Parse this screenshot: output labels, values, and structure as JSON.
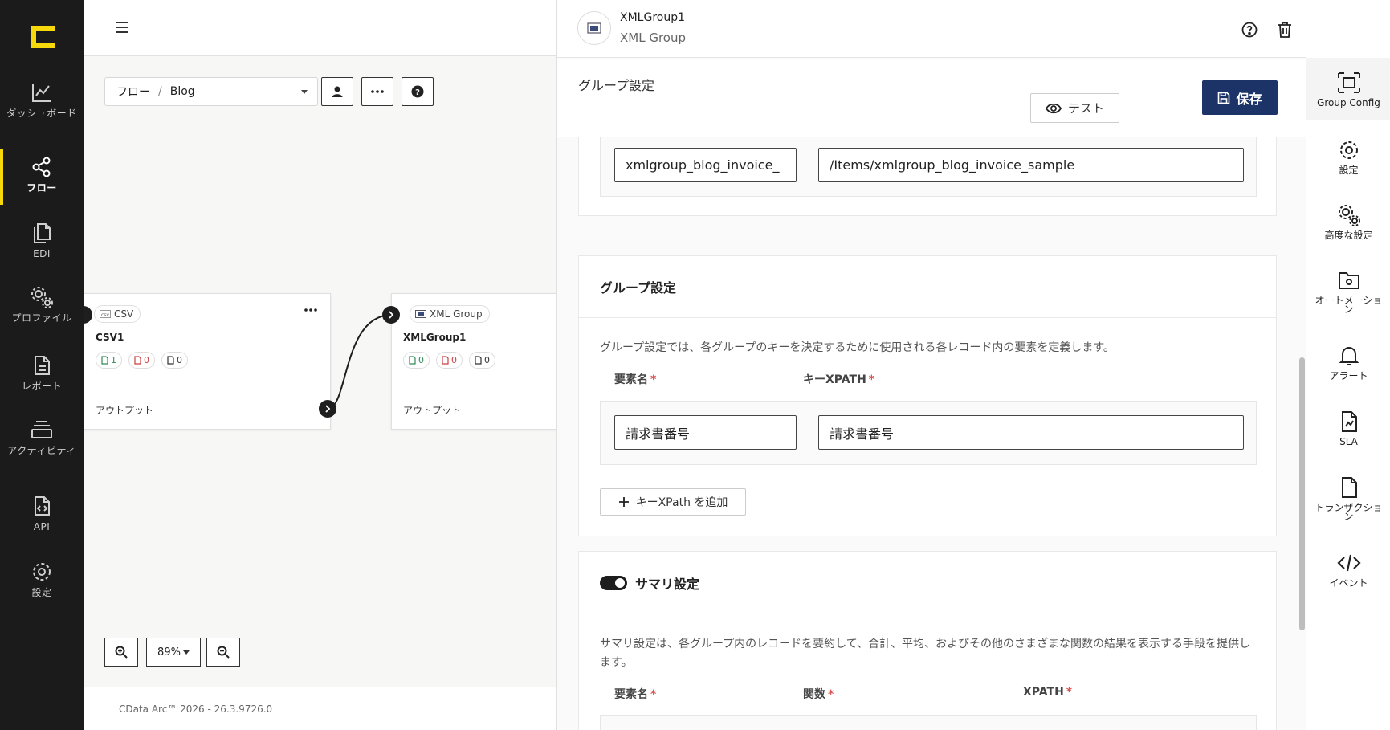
{
  "nav": {
    "items": [
      {
        "label": "ダッシュボード",
        "icon": "chart-line-icon"
      },
      {
        "label": "フロー",
        "icon": "share-nodes-icon"
      },
      {
        "label": "EDI",
        "icon": "documents-icon"
      },
      {
        "label": "プロファイル",
        "icon": "gears-icon"
      },
      {
        "label": "レポート",
        "icon": "report-icon"
      },
      {
        "label": "アクティビティ",
        "icon": "layers-icon"
      },
      {
        "label": "API",
        "icon": "code-file-icon"
      },
      {
        "label": "設定",
        "icon": "gear-icon"
      }
    ],
    "active": "フロー",
    "accent": "#f5d90a"
  },
  "canvas": {
    "breadcrumb": {
      "root": "フロー",
      "separator": "/",
      "current": "Blog"
    },
    "nodes": [
      {
        "type": "CSV",
        "name": "CSV1",
        "stats": {
          "success": "1",
          "error": "0",
          "pending": "0"
        },
        "output": "アウトプット"
      },
      {
        "type": "XML Group",
        "name": "XMLGroup1",
        "stats": {
          "success": "0",
          "error": "0",
          "pending": "0"
        },
        "output": "アウトプット"
      }
    ],
    "zoom": "89%",
    "version": "CData Arc™ 2026 - 26.3.9726.0"
  },
  "panel": {
    "title": "XMLGroup1",
    "subtitle": "XML Group",
    "section": "グループ設定",
    "test_label": "テスト",
    "save_label": "保存",
    "save_color": "#1b3366",
    "top_row": {
      "name_value": "xmlgroup_blog_invoice_",
      "xpath_value": "/Items/xmlgroup_blog_invoice_sample"
    },
    "group_card": {
      "title": "グループ設定",
      "description": "グループ設定では、各グループのキーを決定するために使用される各レコード内の要素を定義します。",
      "col_name": "要素名",
      "col_xpath": "キーXPATH",
      "required_mark": "*",
      "row": {
        "name": "請求書番号",
        "xpath": "請求書番号"
      },
      "add_label": "キーXPath を追加"
    },
    "summary_card": {
      "title": "サマリ設定",
      "toggle_on": true,
      "description": "サマリ設定は、各グループ内のレコードを要約して、合計、平均、およびその他のさまざまな関数の結果を表示する手段を提供します。",
      "col_name": "要素名",
      "col_function": "関数",
      "col_xpath": "XPATH",
      "required_mark": "*"
    }
  },
  "rail": {
    "items": [
      {
        "label": "Group Config",
        "icon": "group-config-icon"
      },
      {
        "label": "設定",
        "icon": "gear-icon"
      },
      {
        "label": "高度な設定",
        "icon": "gears-icon"
      },
      {
        "label": "オートメーション",
        "icon": "automation-folder-icon"
      },
      {
        "label": "アラート",
        "icon": "bell-icon"
      },
      {
        "label": "SLA",
        "icon": "sla-file-icon"
      },
      {
        "label": "トランザクション",
        "icon": "file-icon"
      },
      {
        "label": "イベント",
        "icon": "code-icon"
      }
    ],
    "active": "Group Config"
  }
}
